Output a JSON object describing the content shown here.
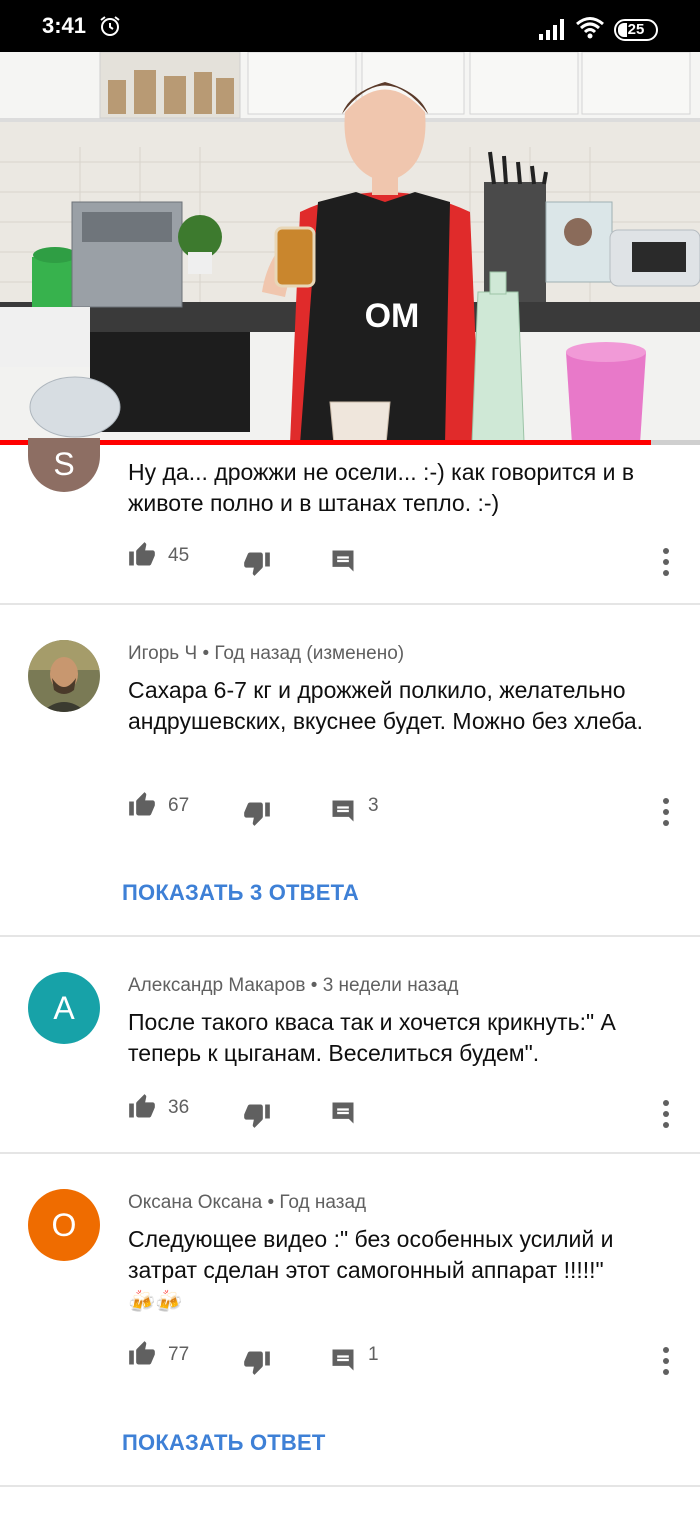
{
  "status_bar": {
    "time": "3:41",
    "battery": "25"
  },
  "video": {
    "progress_fraction": 0.93,
    "apron_logo": "OM"
  },
  "comments": [
    {
      "author": "",
      "avatar_letter": "S",
      "avatar_color": "#8d6e63",
      "text": "Ну да... дрожжи не осели... :-) как говорится и в животе полно и в штанах тепло. :-)",
      "likes": "45",
      "replies_count": ""
    },
    {
      "author": "Игорь Ч",
      "time": "Год назад (изменено)",
      "avatar_letter": "",
      "avatar_color": "#6b6a55",
      "text": "Сахара 6-7 кг и дрожжей полкило, желательно андрушевских, вкуснее будет. Можно без хлеба.",
      "likes": "67",
      "replies_count": "3",
      "show_replies": "ПОКАЗАТЬ 3 ОТВЕТА"
    },
    {
      "author": "Александр Макаров",
      "time": "3 недели назад",
      "avatar_letter": "А",
      "avatar_color": "#17a2a8",
      "text": "После такого кваса так и хочется крикнуть:\" А теперь к цыганам. Веселиться будем\".",
      "likes": "36",
      "replies_count": ""
    },
    {
      "author": "Оксана Оксана",
      "time": "Год назад",
      "avatar_letter": "О",
      "avatar_color": "#ef6c00",
      "text": "Следующее видео :\" без особенных усилий и затрат сделан этот самогонный аппарат !!!!!\"",
      "emoji": "🍻🍻",
      "likes": "77",
      "replies_count": "1",
      "show_replies": "ПОКАЗАТЬ ОТВЕТ"
    }
  ],
  "separator": "•",
  "colors": {
    "link": "#3e80d6",
    "progress": "#ff0000",
    "secondary_text": "#606060"
  }
}
